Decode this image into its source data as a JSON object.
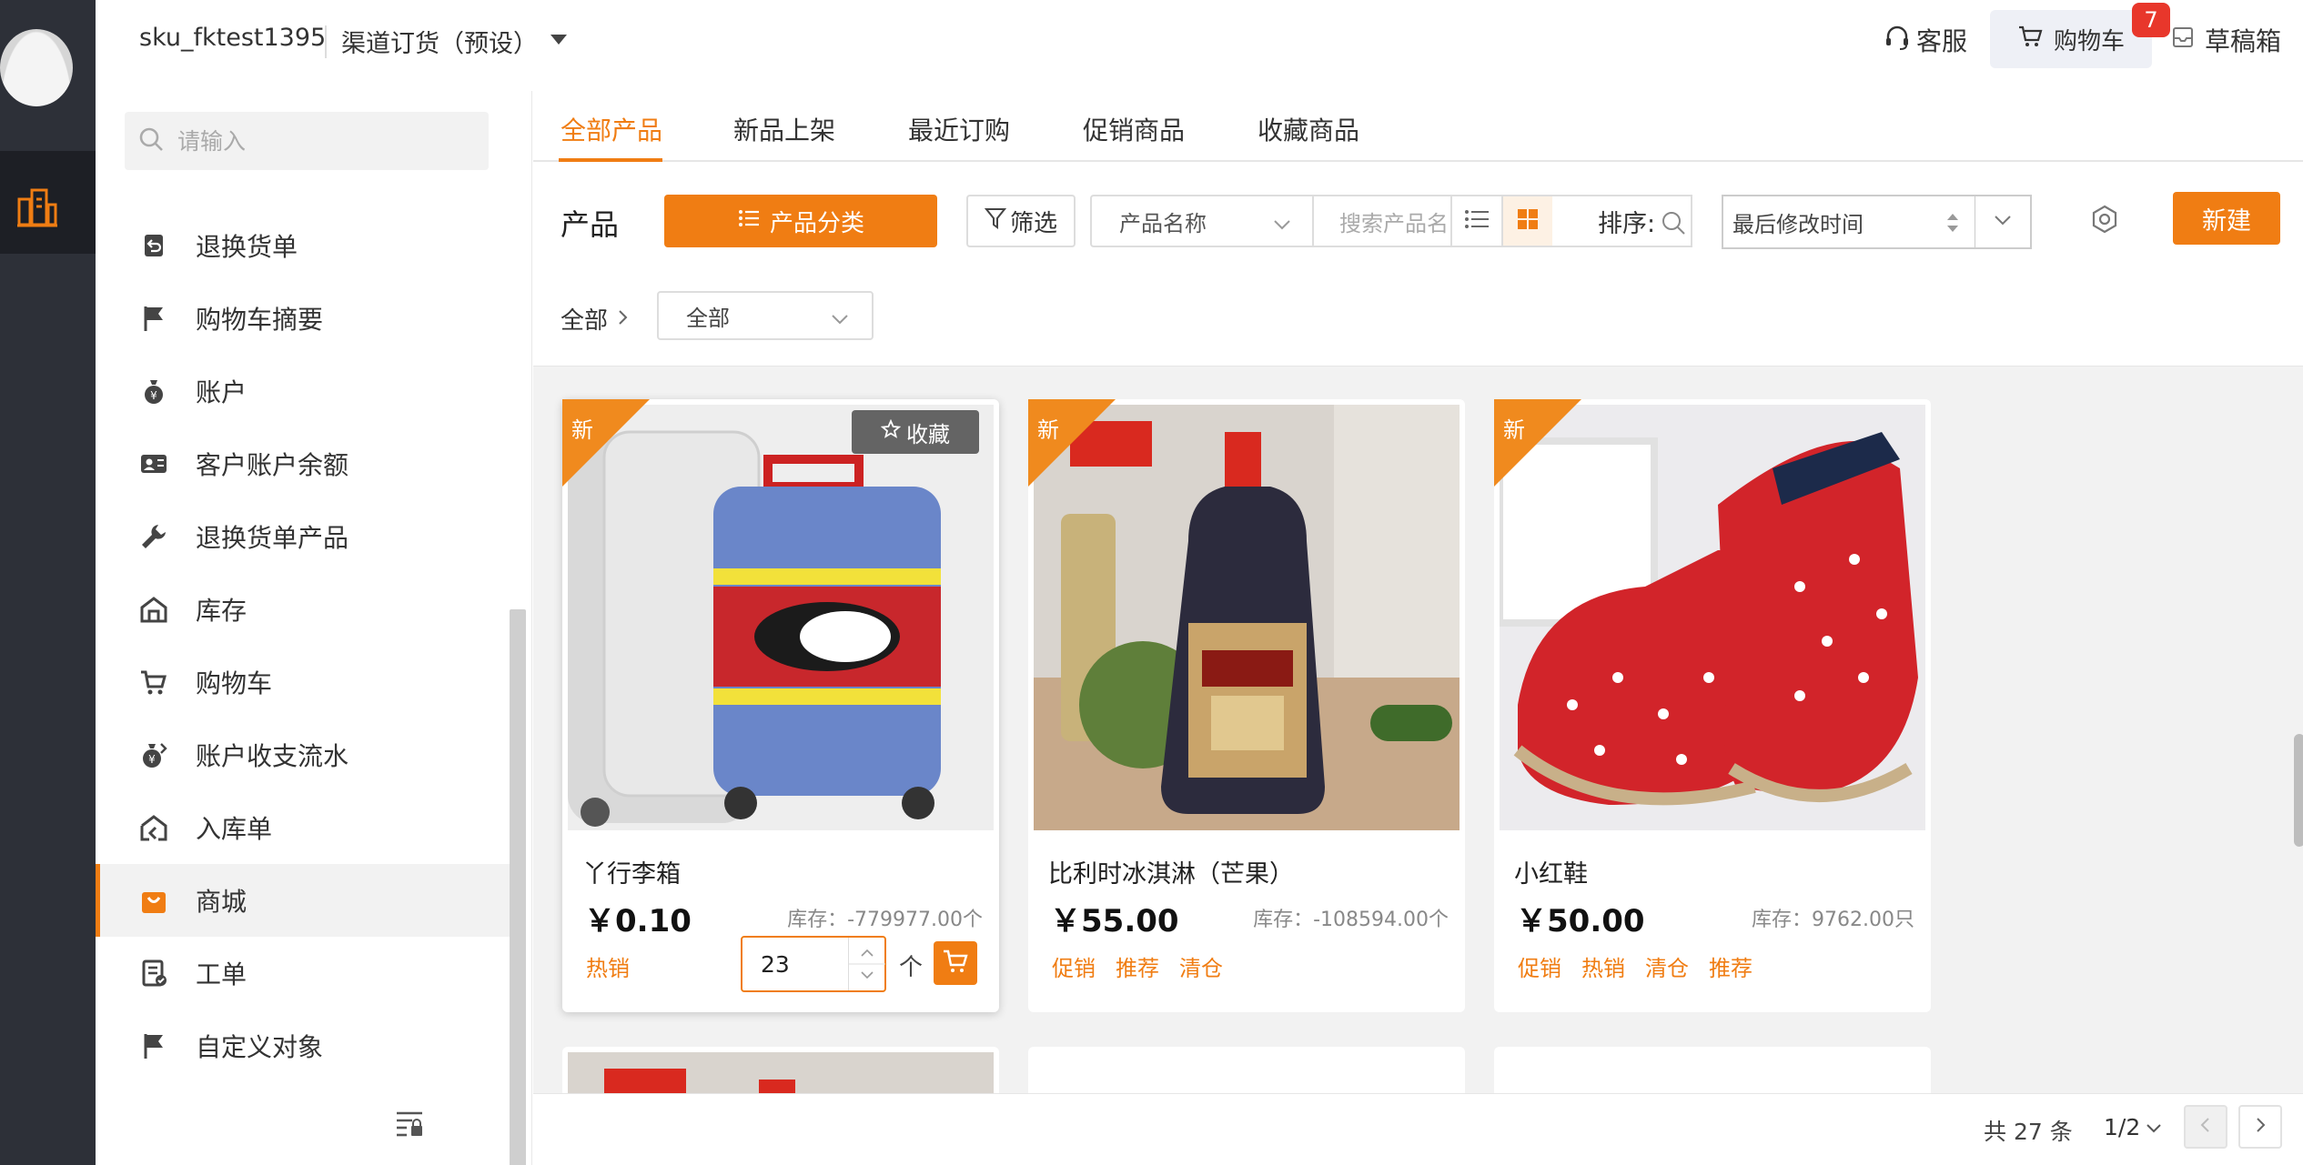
{
  "topbar": {
    "username": "sku_fktest1395",
    "channel": "渠道订货（预设）",
    "service_label": "客服",
    "cart_label": "购物车",
    "cart_badge": "7",
    "draft_label": "草稿箱"
  },
  "sidebar": {
    "search_placeholder": "请输入",
    "items": [
      {
        "label": "退换货单",
        "icon": "return-order-icon"
      },
      {
        "label": "购物车摘要",
        "icon": "flag-icon"
      },
      {
        "label": "账户",
        "icon": "money-bag-icon"
      },
      {
        "label": "客户账户余额",
        "icon": "id-card-icon"
      },
      {
        "label": "退换货单产品",
        "icon": "wrench-icon"
      },
      {
        "label": "库存",
        "icon": "warehouse-icon"
      },
      {
        "label": "购物车",
        "icon": "cart-icon"
      },
      {
        "label": "账户收支流水",
        "icon": "money-flow-icon"
      },
      {
        "label": "入库单",
        "icon": "inbound-icon"
      },
      {
        "label": "商城",
        "icon": "shop-bag-icon",
        "active": true
      },
      {
        "label": "工单",
        "icon": "work-order-icon"
      },
      {
        "label": "自定义对象",
        "icon": "flag-icon"
      }
    ]
  },
  "tabs": [
    {
      "label": "全部产品",
      "active": true
    },
    {
      "label": "新品上架"
    },
    {
      "label": "最近订购"
    },
    {
      "label": "促销商品"
    },
    {
      "label": "收藏商品"
    }
  ],
  "toolbar": {
    "title": "产品",
    "category_button": "产品分类",
    "filter_button": "筛选",
    "field_select": "产品名称",
    "search_placeholder": "搜索产品名",
    "sort_label": "排序:",
    "sort_value": "最后修改时间",
    "new_button": "新建"
  },
  "breadcrumb": {
    "root": "全部",
    "select_value": "全部"
  },
  "products": [
    {
      "name": "丫行李箱",
      "price": "￥0.10",
      "stock": "库存：-779977.00个",
      "badge": "新",
      "favorite": "收藏",
      "tags": [
        "热销"
      ],
      "qty": "23",
      "unit": "个"
    },
    {
      "name": "比利时冰淇淋（芒果）",
      "price": "￥55.00",
      "stock": "库存：-108594.00个",
      "badge": "新",
      "tags": [
        "促销",
        "推荐",
        "清仓"
      ]
    },
    {
      "name": "小红鞋",
      "price": "￥50.00",
      "stock": "库存：9762.00只",
      "badge": "新",
      "tags": [
        "促销",
        "热销",
        "清仓",
        "推荐"
      ]
    }
  ],
  "pagination": {
    "total": "共 27 条",
    "page": "1/2"
  },
  "colors": {
    "accent": "#f07d13",
    "rail": "#2d3038",
    "badge_red": "#e8372b"
  }
}
